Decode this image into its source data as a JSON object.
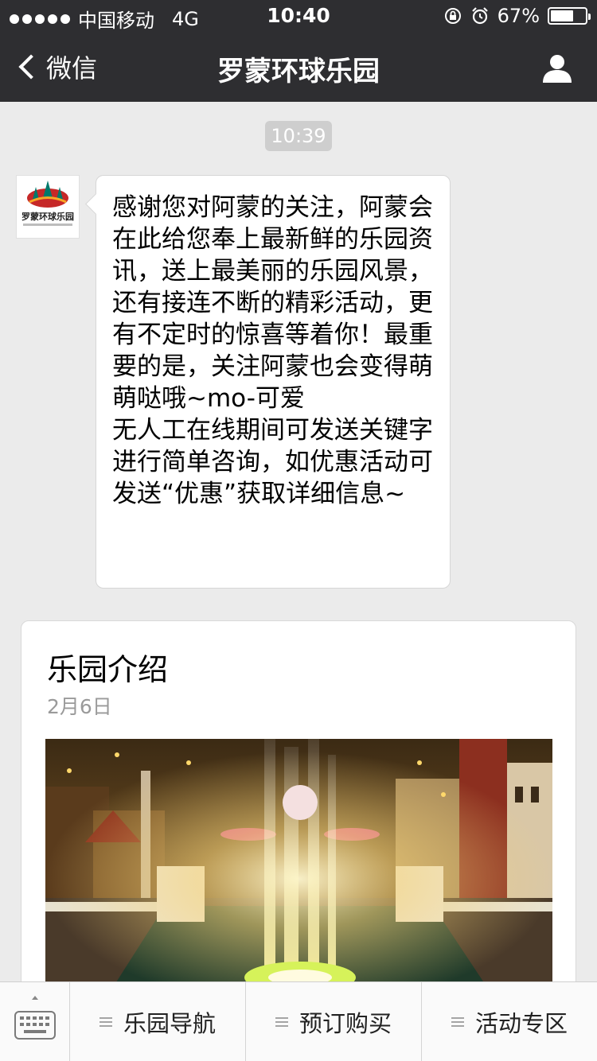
{
  "status_bar": {
    "carrier": "中国移动",
    "network": "4G",
    "time": "10:40",
    "battery": "67%",
    "battery_level": 0.67
  },
  "nav": {
    "back_label": "微信",
    "title": "罗蒙环球乐园",
    "profile_icon": "user-icon"
  },
  "chat": {
    "timestamp": "10:39",
    "avatar_logo_text": "罗蒙环球乐园",
    "message": "感谢您对阿蒙的关注，阿蒙会在此给您奉上最新鲜的乐园资讯，送上最美丽的乐园风景，还有接连不断的精彩活动，更有不定时的惊喜等着你！最重要的是，关注阿蒙也会变得萌萌哒哦~mo-可爱\n无人工在线期间可发送关键字进行简单咨询，如优惠活动可发送“优惠”获取详细信息~"
  },
  "card": {
    "title": "乐园介绍",
    "date": "2月6日"
  },
  "menu": {
    "keyboard_icon": "keyboard-icon",
    "items": [
      {
        "label": "乐园导航"
      },
      {
        "label": "预订购买"
      },
      {
        "label": "活动专区"
      }
    ]
  },
  "colors": {
    "header_bg": "#2e2e31",
    "chat_bg": "#ebebeb",
    "timestamp_bg": "#cecece"
  }
}
